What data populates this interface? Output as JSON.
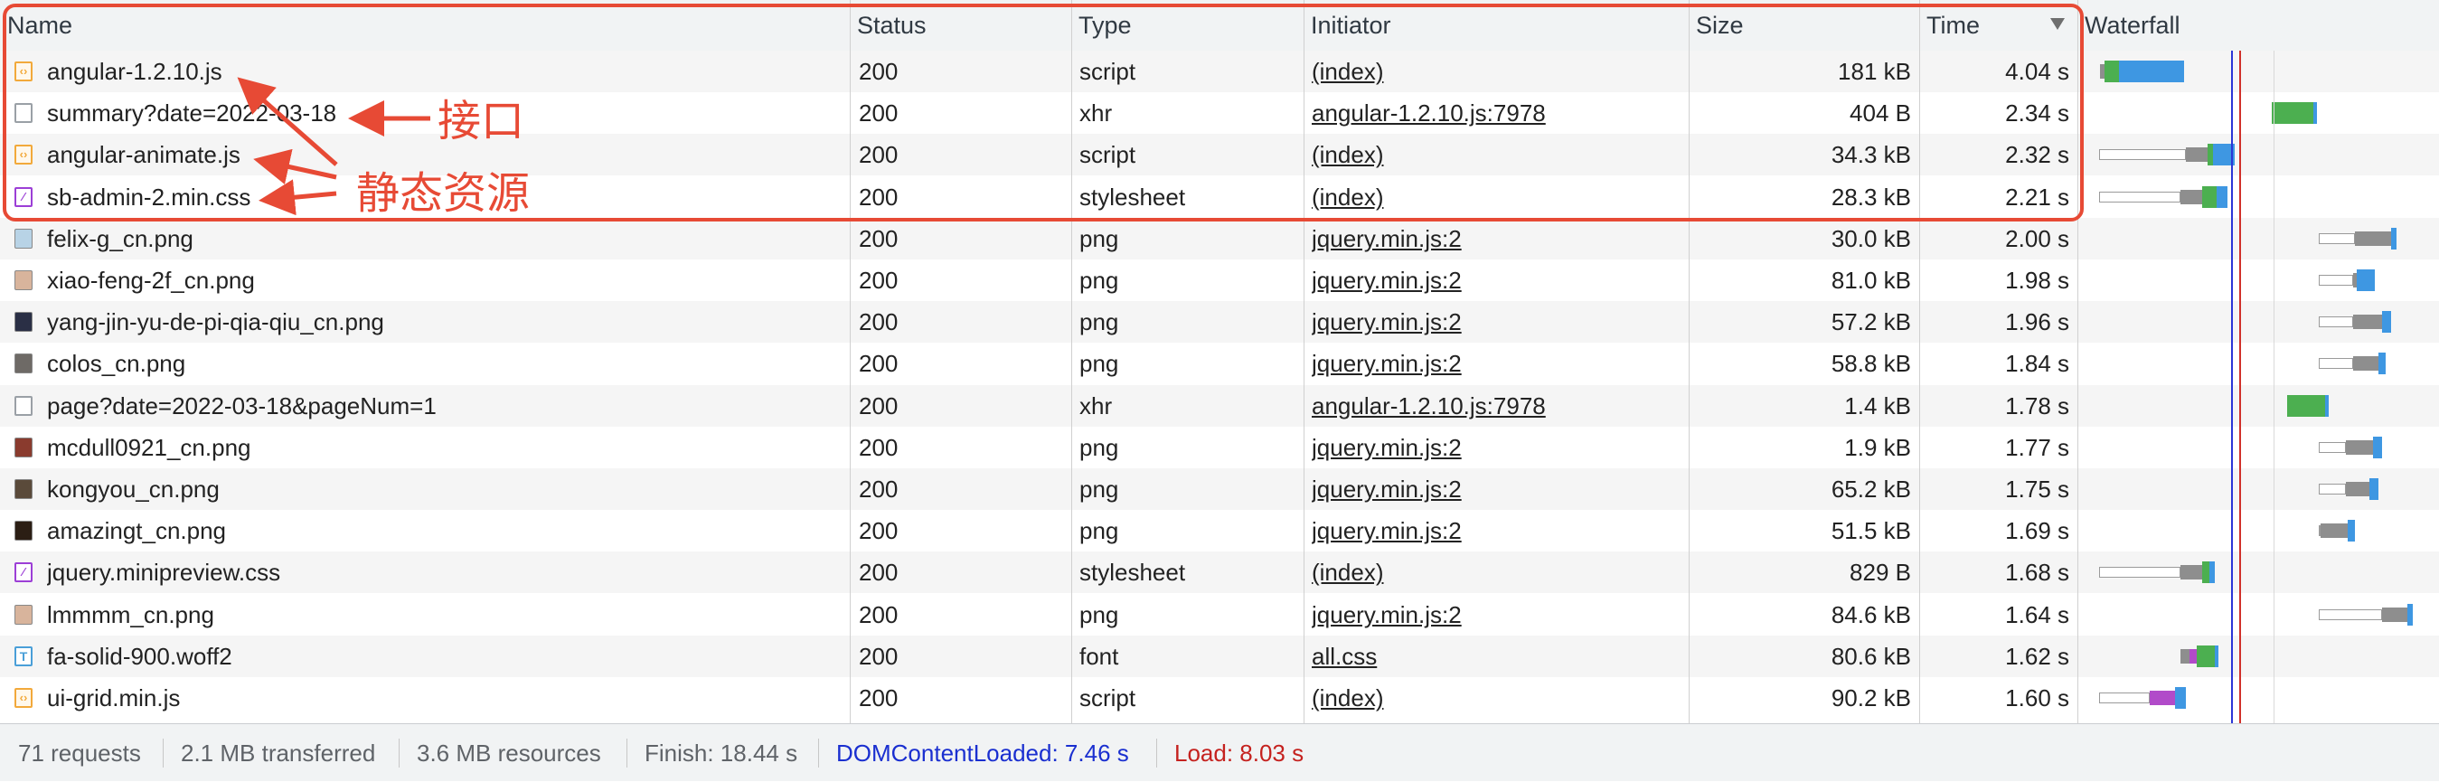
{
  "columns": {
    "name": "Name",
    "status": "Status",
    "type": "Type",
    "initiator": "Initiator",
    "size": "Size",
    "time": "Time",
    "waterfall": "Waterfall"
  },
  "sort": {
    "column": "Time",
    "direction": "descending"
  },
  "rows": [
    {
      "name": "angular-1.2.10.js",
      "status": "200",
      "type": "script",
      "initiator": "(index)",
      "size": "181 kB",
      "time": "4.04 s",
      "icon": "script-file-icon"
    },
    {
      "name": "summary?date=2022-03-18",
      "status": "200",
      "type": "xhr",
      "initiator": "angular-1.2.10.js:7978",
      "size": "404 B",
      "time": "2.34 s",
      "icon": "document-file-icon"
    },
    {
      "name": "angular-animate.js",
      "status": "200",
      "type": "script",
      "initiator": "(index)",
      "size": "34.3 kB",
      "time": "2.32 s",
      "icon": "script-file-icon"
    },
    {
      "name": "sb-admin-2.min.css",
      "status": "200",
      "type": "stylesheet",
      "initiator": "(index)",
      "size": "28.3 kB",
      "time": "2.21 s",
      "icon": "stylesheet-file-icon"
    },
    {
      "name": "felix-g_cn.png",
      "status": "200",
      "type": "png",
      "initiator": "jquery.min.js:2",
      "size": "30.0 kB",
      "time": "2.00 s",
      "icon": "image-thumbnail-icon"
    },
    {
      "name": "xiao-feng-2f_cn.png",
      "status": "200",
      "type": "png",
      "initiator": "jquery.min.js:2",
      "size": "81.0 kB",
      "time": "1.98 s",
      "icon": "image-thumbnail-icon"
    },
    {
      "name": "yang-jin-yu-de-pi-qia-qiu_cn.png",
      "status": "200",
      "type": "png",
      "initiator": "jquery.min.js:2",
      "size": "57.2 kB",
      "time": "1.96 s",
      "icon": "image-thumbnail-icon"
    },
    {
      "name": "colos_cn.png",
      "status": "200",
      "type": "png",
      "initiator": "jquery.min.js:2",
      "size": "58.8 kB",
      "time": "1.84 s",
      "icon": "image-thumbnail-icon"
    },
    {
      "name": "page?date=2022-03-18&pageNum=1",
      "status": "200",
      "type": "xhr",
      "initiator": "angular-1.2.10.js:7978",
      "size": "1.4 kB",
      "time": "1.78 s",
      "icon": "document-file-icon"
    },
    {
      "name": "mcdull0921_cn.png",
      "status": "200",
      "type": "png",
      "initiator": "jquery.min.js:2",
      "size": "1.9 kB",
      "time": "1.77 s",
      "icon": "image-thumbnail-icon"
    },
    {
      "name": "kongyou_cn.png",
      "status": "200",
      "type": "png",
      "initiator": "jquery.min.js:2",
      "size": "65.2 kB",
      "time": "1.75 s",
      "icon": "image-thumbnail-icon"
    },
    {
      "name": "amazingt_cn.png",
      "status": "200",
      "type": "png",
      "initiator": "jquery.min.js:2",
      "size": "51.5 kB",
      "time": "1.69 s",
      "icon": "image-thumbnail-icon"
    },
    {
      "name": "jquery.minipreview.css",
      "status": "200",
      "type": "stylesheet",
      "initiator": "(index)",
      "size": "829 B",
      "time": "1.68 s",
      "icon": "stylesheet-file-icon"
    },
    {
      "name": "lmmmm_cn.png",
      "status": "200",
      "type": "png",
      "initiator": "jquery.min.js:2",
      "size": "84.6 kB",
      "time": "1.64 s",
      "icon": "image-thumbnail-icon"
    },
    {
      "name": "fa-solid-900.woff2",
      "status": "200",
      "type": "font",
      "initiator": "all.css",
      "size": "80.6 kB",
      "time": "1.62 s",
      "icon": "font-file-icon"
    },
    {
      "name": "ui-grid.min.js",
      "status": "200",
      "type": "script",
      "initiator": "(index)",
      "size": "90.2 kB",
      "time": "1.60 s",
      "icon": "script-file-icon"
    }
  ],
  "annotations": {
    "api_label": "接口",
    "static_label": "静态资源"
  },
  "status_bar": {
    "requests": "71 requests",
    "transferred": "2.1 MB transferred",
    "resources": "3.6 MB resources",
    "finish": "Finish: 18.44 s",
    "dom_content_loaded": "DOMContentLoaded: 7.46 s",
    "load": "Load: 8.03 s"
  },
  "colors": {
    "annotation": "#e74a35",
    "dom_content_loaded_line": "#2b36d6",
    "load_line": "#d1302a",
    "waiting": "#4caf50",
    "download": "#3e97e2"
  }
}
